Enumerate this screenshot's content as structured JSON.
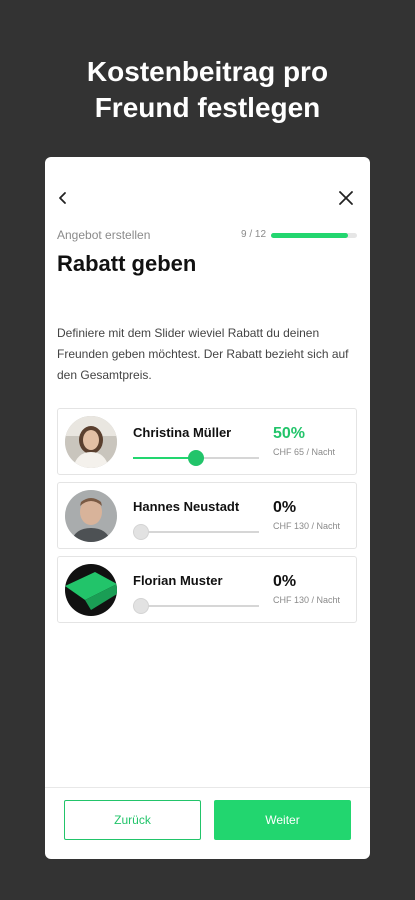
{
  "headline": {
    "line1": "Kostenbeitrag pro",
    "line2": "Freund festlegen"
  },
  "header": {
    "back_icon": "chevron-left-icon",
    "close_icon": "close-icon"
  },
  "progress": {
    "label": "Angebot erstellen",
    "step": "9 / 12",
    "fraction": 0.9
  },
  "page": {
    "title": "Rabatt geben"
  },
  "description": "Definiere mit dem Slider wieviel Rabatt du deinen Freunden geben möchtest. Der Rabatt bezieht sich auf den Gesamtpreis.",
  "friends": [
    {
      "name": "Christina Müller",
      "discount": "50%",
      "price": "CHF 65 / Nacht",
      "slider_value": 0.5,
      "active": true
    },
    {
      "name": "Hannes Neustadt",
      "discount": "0%",
      "price": "CHF 130 / Nacht",
      "slider_value": 0,
      "active": false
    },
    {
      "name": "Florian Muster",
      "discount": "0%",
      "price": "CHF 130 / Nacht",
      "slider_value": 0,
      "active": false
    }
  ],
  "footer": {
    "back_label": "Zurück",
    "next_label": "Weiter"
  },
  "colors": {
    "accent": "#22d66f",
    "background": "#333333",
    "card": "#ffffff"
  }
}
